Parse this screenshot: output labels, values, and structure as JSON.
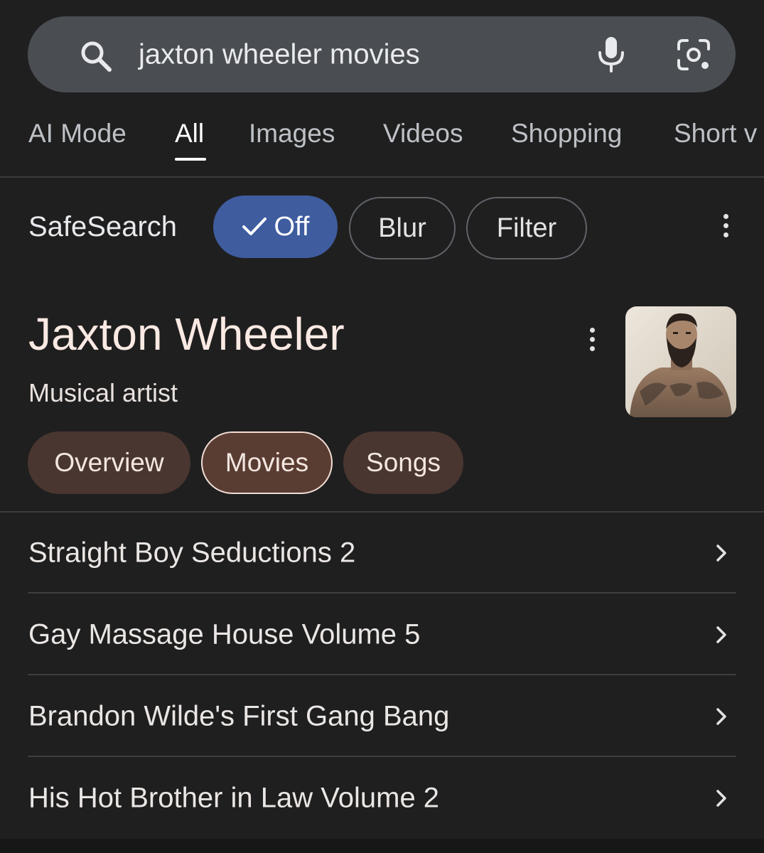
{
  "search": {
    "query": "jaxton wheeler movies",
    "icons": [
      "search-icon",
      "microphone-icon",
      "camera-lens-icon"
    ]
  },
  "tabs": [
    {
      "label": "AI Mode",
      "active": false
    },
    {
      "label": "All",
      "active": true
    },
    {
      "label": "Images",
      "active": false
    },
    {
      "label": "Videos",
      "active": false
    },
    {
      "label": "Shopping",
      "active": false
    },
    {
      "label": "Short v",
      "active": false
    }
  ],
  "safesearch": {
    "label": "SafeSearch",
    "options": [
      {
        "label": "Off",
        "selected": true
      },
      {
        "label": "Blur",
        "selected": false
      },
      {
        "label": "Filter",
        "selected": false
      }
    ]
  },
  "entity": {
    "name": "Jaxton Wheeler",
    "type": "Musical artist",
    "chips": [
      {
        "label": "Overview",
        "selected": false
      },
      {
        "label": "Movies",
        "selected": true
      },
      {
        "label": "Songs",
        "selected": false
      }
    ]
  },
  "movies": [
    {
      "title": "Straight Boy Seductions 2"
    },
    {
      "title": "Gay Massage House Volume 5"
    },
    {
      "title": "Brandon Wilde's First Gang Bang"
    },
    {
      "title": "His Hot Brother in Law Volume 2"
    }
  ],
  "colors": {
    "background": "#1f1f1f",
    "search_bar": "#4a4d52",
    "safesearch_selected": "#3e5c9e",
    "entity_chip": "#4a3630",
    "entity_chip_selected": "#5a3d32"
  }
}
